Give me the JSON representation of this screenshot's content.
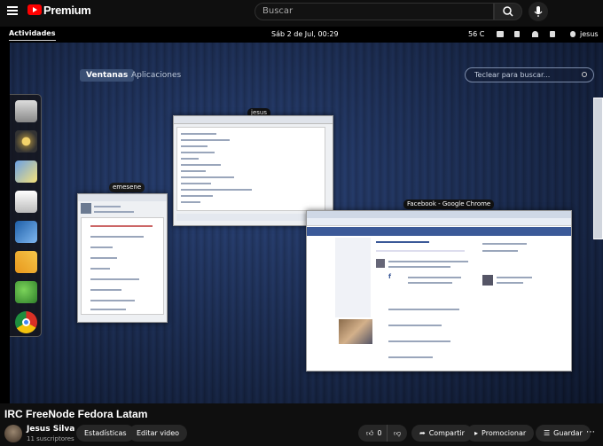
{
  "youtube": {
    "brand": "Premium",
    "search_placeholder": "Buscar"
  },
  "gnome": {
    "activities": "Actividades",
    "clock": "Sáb  2 de Jul, 00:29",
    "temperature": "56 C",
    "user": "jesus",
    "tab_windows": "Ventanas",
    "tab_apps": "Aplicaciones",
    "search_placeholder": "Teclear para buscar..."
  },
  "windows": {
    "emesene": "emesene",
    "facebook": "Facebook - Google Chrome",
    "chat_top": "jesus"
  },
  "video": {
    "title": "IRC FreeNode Fedora Latam"
  },
  "channel": {
    "name": "Jesus Silva",
    "subscribers": "11 suscriptores"
  },
  "actions": {
    "stats": "Estadísticas",
    "edit": "Editar video",
    "likes": "0",
    "share": "Compartir",
    "promote": "Promocionar",
    "save": "Guardar"
  },
  "colors": {
    "youtube_red": "#ff0000",
    "facebook_blue": "#3b5998",
    "desktop_blue": "#1d305a"
  }
}
